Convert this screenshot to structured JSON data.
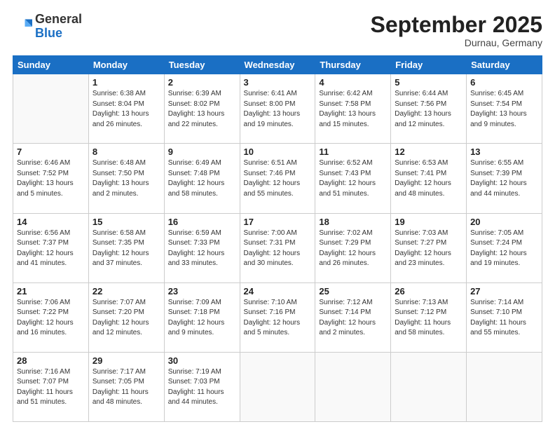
{
  "header": {
    "logo": {
      "general": "General",
      "blue": "Blue"
    },
    "title": "September 2025",
    "location": "Durnau, Germany"
  },
  "days_of_week": [
    "Sunday",
    "Monday",
    "Tuesday",
    "Wednesday",
    "Thursday",
    "Friday",
    "Saturday"
  ],
  "weeks": [
    [
      {
        "day": "",
        "info": ""
      },
      {
        "day": "1",
        "info": "Sunrise: 6:38 AM\nSunset: 8:04 PM\nDaylight: 13 hours\nand 26 minutes."
      },
      {
        "day": "2",
        "info": "Sunrise: 6:39 AM\nSunset: 8:02 PM\nDaylight: 13 hours\nand 22 minutes."
      },
      {
        "day": "3",
        "info": "Sunrise: 6:41 AM\nSunset: 8:00 PM\nDaylight: 13 hours\nand 19 minutes."
      },
      {
        "day": "4",
        "info": "Sunrise: 6:42 AM\nSunset: 7:58 PM\nDaylight: 13 hours\nand 15 minutes."
      },
      {
        "day": "5",
        "info": "Sunrise: 6:44 AM\nSunset: 7:56 PM\nDaylight: 13 hours\nand 12 minutes."
      },
      {
        "day": "6",
        "info": "Sunrise: 6:45 AM\nSunset: 7:54 PM\nDaylight: 13 hours\nand 9 minutes."
      }
    ],
    [
      {
        "day": "7",
        "info": "Sunrise: 6:46 AM\nSunset: 7:52 PM\nDaylight: 13 hours\nand 5 minutes."
      },
      {
        "day": "8",
        "info": "Sunrise: 6:48 AM\nSunset: 7:50 PM\nDaylight: 13 hours\nand 2 minutes."
      },
      {
        "day": "9",
        "info": "Sunrise: 6:49 AM\nSunset: 7:48 PM\nDaylight: 12 hours\nand 58 minutes."
      },
      {
        "day": "10",
        "info": "Sunrise: 6:51 AM\nSunset: 7:46 PM\nDaylight: 12 hours\nand 55 minutes."
      },
      {
        "day": "11",
        "info": "Sunrise: 6:52 AM\nSunset: 7:43 PM\nDaylight: 12 hours\nand 51 minutes."
      },
      {
        "day": "12",
        "info": "Sunrise: 6:53 AM\nSunset: 7:41 PM\nDaylight: 12 hours\nand 48 minutes."
      },
      {
        "day": "13",
        "info": "Sunrise: 6:55 AM\nSunset: 7:39 PM\nDaylight: 12 hours\nand 44 minutes."
      }
    ],
    [
      {
        "day": "14",
        "info": "Sunrise: 6:56 AM\nSunset: 7:37 PM\nDaylight: 12 hours\nand 41 minutes."
      },
      {
        "day": "15",
        "info": "Sunrise: 6:58 AM\nSunset: 7:35 PM\nDaylight: 12 hours\nand 37 minutes."
      },
      {
        "day": "16",
        "info": "Sunrise: 6:59 AM\nSunset: 7:33 PM\nDaylight: 12 hours\nand 33 minutes."
      },
      {
        "day": "17",
        "info": "Sunrise: 7:00 AM\nSunset: 7:31 PM\nDaylight: 12 hours\nand 30 minutes."
      },
      {
        "day": "18",
        "info": "Sunrise: 7:02 AM\nSunset: 7:29 PM\nDaylight: 12 hours\nand 26 minutes."
      },
      {
        "day": "19",
        "info": "Sunrise: 7:03 AM\nSunset: 7:27 PM\nDaylight: 12 hours\nand 23 minutes."
      },
      {
        "day": "20",
        "info": "Sunrise: 7:05 AM\nSunset: 7:24 PM\nDaylight: 12 hours\nand 19 minutes."
      }
    ],
    [
      {
        "day": "21",
        "info": "Sunrise: 7:06 AM\nSunset: 7:22 PM\nDaylight: 12 hours\nand 16 minutes."
      },
      {
        "day": "22",
        "info": "Sunrise: 7:07 AM\nSunset: 7:20 PM\nDaylight: 12 hours\nand 12 minutes."
      },
      {
        "day": "23",
        "info": "Sunrise: 7:09 AM\nSunset: 7:18 PM\nDaylight: 12 hours\nand 9 minutes."
      },
      {
        "day": "24",
        "info": "Sunrise: 7:10 AM\nSunset: 7:16 PM\nDaylight: 12 hours\nand 5 minutes."
      },
      {
        "day": "25",
        "info": "Sunrise: 7:12 AM\nSunset: 7:14 PM\nDaylight: 12 hours\nand 2 minutes."
      },
      {
        "day": "26",
        "info": "Sunrise: 7:13 AM\nSunset: 7:12 PM\nDaylight: 11 hours\nand 58 minutes."
      },
      {
        "day": "27",
        "info": "Sunrise: 7:14 AM\nSunset: 7:10 PM\nDaylight: 11 hours\nand 55 minutes."
      }
    ],
    [
      {
        "day": "28",
        "info": "Sunrise: 7:16 AM\nSunset: 7:07 PM\nDaylight: 11 hours\nand 51 minutes."
      },
      {
        "day": "29",
        "info": "Sunrise: 7:17 AM\nSunset: 7:05 PM\nDaylight: 11 hours\nand 48 minutes."
      },
      {
        "day": "30",
        "info": "Sunrise: 7:19 AM\nSunset: 7:03 PM\nDaylight: 11 hours\nand 44 minutes."
      },
      {
        "day": "",
        "info": ""
      },
      {
        "day": "",
        "info": ""
      },
      {
        "day": "",
        "info": ""
      },
      {
        "day": "",
        "info": ""
      }
    ]
  ]
}
